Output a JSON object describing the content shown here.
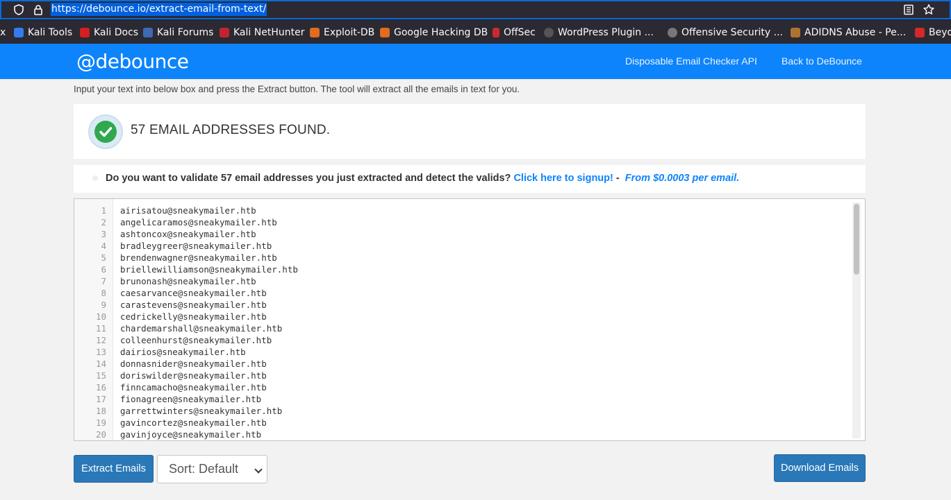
{
  "browser": {
    "url": "https://debounce.io/extract-email-from-text/"
  },
  "bookmarks": [
    {
      "label": "x",
      "color": "#2b2a33"
    },
    {
      "label": "Kali Tools",
      "color": "#367bf0"
    },
    {
      "label": "Kali Docs",
      "color": "#d21f1f"
    },
    {
      "label": "Kali Forums",
      "color": "#3c6ab5"
    },
    {
      "label": "Kali NetHunter",
      "color": "#c2242f"
    },
    {
      "label": "Exploit-DB",
      "color": "#e06c1f"
    },
    {
      "label": "Google Hacking DB",
      "color": "#e06c1f"
    },
    {
      "label": "OffSec",
      "color": "#cc2a2a"
    },
    {
      "label": "WordPress Plugin ...",
      "color": "#555555"
    },
    {
      "label": "Offensive Security ...",
      "color": "#777777"
    },
    {
      "label": "ADIDNS Abuse - Pe...",
      "color": "#b0732e"
    },
    {
      "label": "Beyo",
      "color": "#d62828"
    }
  ],
  "site": {
    "logo": "@debounce",
    "nav": [
      "Disposable Email Checker API",
      "Back to DeBounce"
    ]
  },
  "intro": "Input your text into below box and press the Extract button. The tool will extract all the emails in text for you.",
  "result": {
    "found_text": "57 EMAIL ADDRESSES FOUND."
  },
  "promo": {
    "question": "Do you want to validate 57 email addresses you just extracted and detect the valids?",
    "signup": "Click here to signup!",
    "dash": "-",
    "price": "From $0.0003 per email."
  },
  "emails": [
    "airisatou@sneakymailer.htb",
    "angelicaramos@sneakymailer.htb",
    "ashtoncox@sneakymailer.htb",
    "bradleygreer@sneakymailer.htb",
    "brendenwagner@sneakymailer.htb",
    "briellewilliamson@sneakymailer.htb",
    "brunonash@sneakymailer.htb",
    "caesarvance@sneakymailer.htb",
    "carastevens@sneakymailer.htb",
    "cedrickelly@sneakymailer.htb",
    "chardemarshall@sneakymailer.htb",
    "colleenhurst@sneakymailer.htb",
    "dairios@sneakymailer.htb",
    "donnasnider@sneakymailer.htb",
    "doriswilder@sneakymailer.htb",
    "finncamacho@sneakymailer.htb",
    "fionagreen@sneakymailer.htb",
    "garrettwinters@sneakymailer.htb",
    "gavincortez@sneakymailer.htb",
    "gavinjoyce@sneakymailer.htb"
  ],
  "controls": {
    "extract": "Extract Emails",
    "sort": "Sort: Default",
    "download": "Download Emails"
  }
}
